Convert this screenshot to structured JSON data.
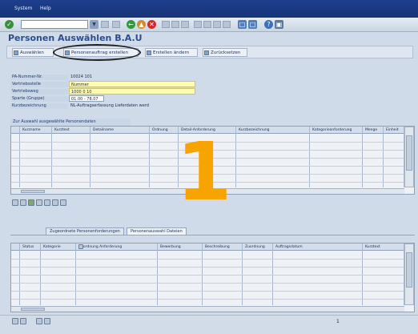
{
  "menubar": {
    "items": [
      "System",
      "Help"
    ]
  },
  "toolbar": {
    "command_value": ""
  },
  "title": "Personen Auswählen B.A.U",
  "app_toolbar": {
    "buttons": [
      "Auswählen",
      "Personenauftrag erstellen",
      "Erstellen ändern",
      "Zurücksetzen"
    ]
  },
  "form": {
    "fields": [
      {
        "label": "PA-Nummer-Nr.",
        "value": "10024 101"
      },
      {
        "label": "Vertriebsstelle",
        "value": "Nummer"
      },
      {
        "label": "Vertriebsweg",
        "value": "1000 0 10"
      },
      {
        "label": "Sparte (Gruppe)",
        "value": "01.00 - 78.07"
      },
      {
        "label": "Kurzbezeichnung",
        "value": "NL-Auftragserfassung Lieferdaten werd"
      }
    ]
  },
  "grid1": {
    "title": "Zur Auswahl ausgewählte Personendaten",
    "columns": [
      "Kurzname",
      "Kurztext",
      "Detailname",
      "Ordnung",
      "Detail-Anforderung",
      "Kurzbezeichnung",
      "Kategorieanforderung",
      "Menge",
      "Einheit"
    ]
  },
  "annotation": "1",
  "tabs": [
    "Zugeordnete Personenforderungen",
    "Personenauswahl Dateien"
  ],
  "grid2": {
    "columns": [
      "Status",
      "Kategorie",
      "Zuordnung Anforderung",
      "Bewerbung",
      "Beschreibung",
      "Zuordnung",
      "Auftragsdatum",
      "Kurztext"
    ]
  },
  "status": {
    "page": "1"
  },
  "colors": {
    "menubar": "#1e3f8e",
    "highlight": "#fffbb0",
    "annotation": "#f7a400",
    "title": "#2d4d8e"
  }
}
